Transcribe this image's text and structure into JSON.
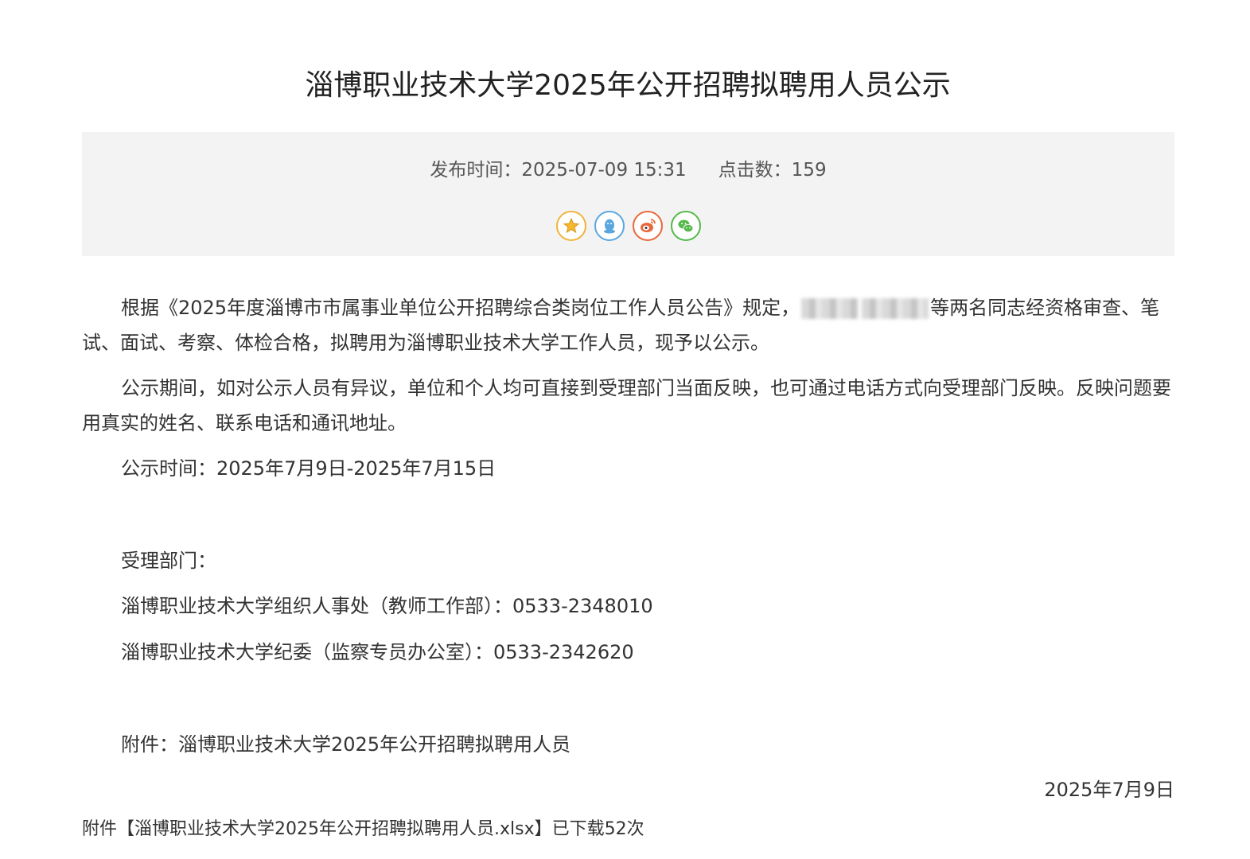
{
  "article": {
    "title": "淄博职业技术大学2025年公开招聘拟聘用人员公示",
    "publish_label": "发布时间：",
    "publish_time": "2025-07-09 15:31",
    "clicks_label": "点击数：",
    "clicks": "159",
    "share_icons": [
      "favorite-star-icon",
      "qq-icon",
      "weibo-icon",
      "wechat-icon"
    ],
    "para1_before": "根据《2025年度淄博市市属事业单位公开招聘综合类岗位工作人员公告》规定，",
    "para1_after": "等两名同志经资格审查、笔试、面试、考察、体检合格，拟聘用为淄博职业技术大学工作人员，现予以公示。",
    "para2": "公示期间，如对公示人员有异议，单位和个人均可直接到受理部门当面反映，也可通过电话方式向受理部门反映。反映问题要用真实的姓名、联系电话和通讯地址。",
    "para3": "公示时间：2025年7月9日-2025年7月15日",
    "dept_label": "受理部门：",
    "dept_1": "淄博职业技术大学组织人事处（教师工作部）：0533-2348010",
    "dept_2": "淄博职业技术大学纪委（监察专员办公室）：0533-2342620",
    "attachment_line": "附件：淄博职业技术大学2025年公开招聘拟聘用人员",
    "sign_date": "2025年7月9日",
    "download_prefix": "附件【",
    "download_file": "淄博职业技术大学2025年公开招聘拟聘用人员.xlsx",
    "download_suffix": "】已下载52次"
  },
  "colors": {
    "meta_bg": "#f3f3f3",
    "favorite": "#f0b43c",
    "qq": "#5aa7e0",
    "weibo": "#e8683a",
    "wechat": "#54b94a"
  }
}
